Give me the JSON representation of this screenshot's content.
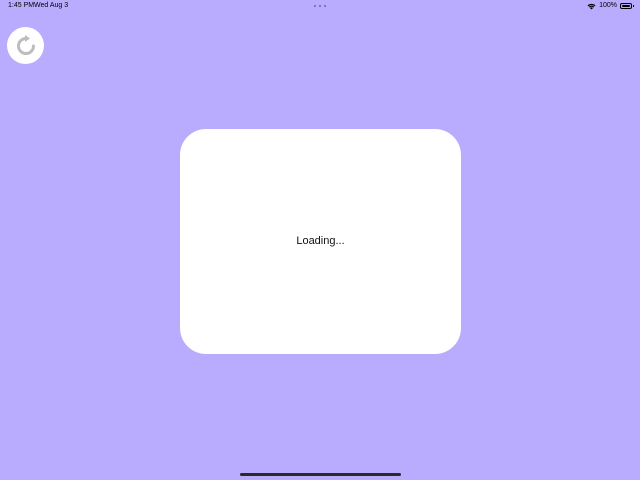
{
  "status_bar": {
    "time": "1:45 PM",
    "date": "Wed Aug 3",
    "battery": "100%",
    "icons": [
      "wifi-icon",
      "battery-icon"
    ]
  },
  "toolbar": {
    "refresh_icon": "refresh-icon"
  },
  "main": {
    "loading_text": "Loading..."
  },
  "colors": {
    "background": "#b9acff",
    "card": "#ffffff",
    "icon_gray": "#bdbdbd"
  }
}
